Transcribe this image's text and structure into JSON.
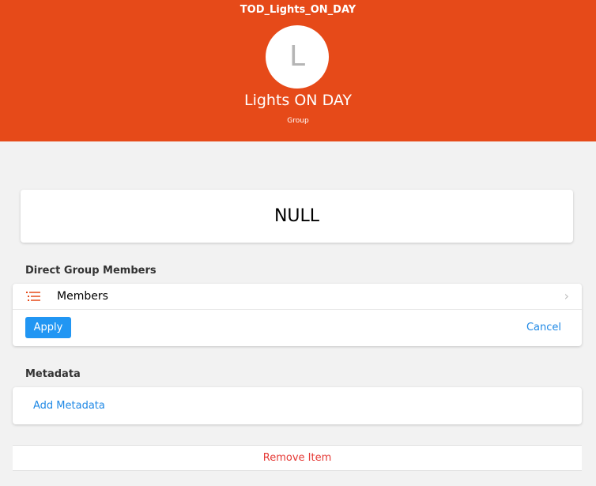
{
  "header": {
    "window_title": "TOD_Lights_ON_DAY",
    "avatar_letter": "L",
    "item_name": "Lights ON DAY",
    "item_type": "Group",
    "background_color": "#e64a19"
  },
  "state": {
    "value": "NULL"
  },
  "members_section": {
    "heading": "Direct Group Members",
    "row_label": "Members",
    "row_icon": "list-icon",
    "apply_label": "Apply",
    "cancel_label": "Cancel"
  },
  "metadata_section": {
    "heading": "Metadata",
    "add_label": "Add Metadata"
  },
  "remove": {
    "label": "Remove Item"
  },
  "colors": {
    "accent": "#2196f3",
    "link": "#1e88e5",
    "danger": "#e53935"
  }
}
